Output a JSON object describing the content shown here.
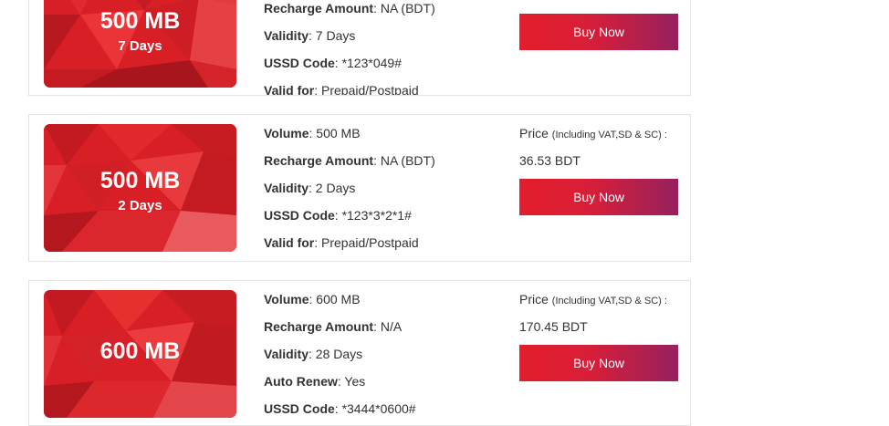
{
  "packs": [
    {
      "image_volume": "500 MB",
      "image_days": "7 Days",
      "details": [
        {
          "label": "Recharge Amount",
          "value": ": NA (BDT)"
        },
        {
          "label": "Validity",
          "value": ": 7 Days"
        },
        {
          "label": "USSD Code",
          "value": ": *123*049#"
        },
        {
          "label": "Valid for",
          "value": ": Prepaid/Postpaid"
        }
      ],
      "buy_label": "Buy Now"
    },
    {
      "image_volume": "500 MB",
      "image_days": "2 Days",
      "details": [
        {
          "label": "Volume",
          "value": ": 500 MB"
        },
        {
          "label": "Recharge Amount",
          "value": ": NA (BDT)"
        },
        {
          "label": "Validity",
          "value": ": 2 Days"
        },
        {
          "label": "USSD Code",
          "value": ": *123*3*2*1#"
        },
        {
          "label": "Valid for",
          "value": ": Prepaid/Postpaid"
        }
      ],
      "price_label": "Price",
      "price_note": "(Including VAT,SD & SC) :",
      "price_value": "36.53 BDT",
      "buy_label": "Buy Now"
    },
    {
      "image_volume": "600 MB",
      "details": [
        {
          "label": "Volume",
          "value": ": 600 MB"
        },
        {
          "label": "Recharge Amount",
          "value": ": N/A"
        },
        {
          "label": "Validity",
          "value": ": 28 Days"
        },
        {
          "label": "Auto Renew",
          "value": ": Yes"
        },
        {
          "label": "USSD Code",
          "value": ": *3444*0600#"
        }
      ],
      "price_label": "Price",
      "price_note": "(Including VAT,SD & SC) :",
      "price_value": "170.45 BDT",
      "buy_label": "Buy Now"
    }
  ]
}
